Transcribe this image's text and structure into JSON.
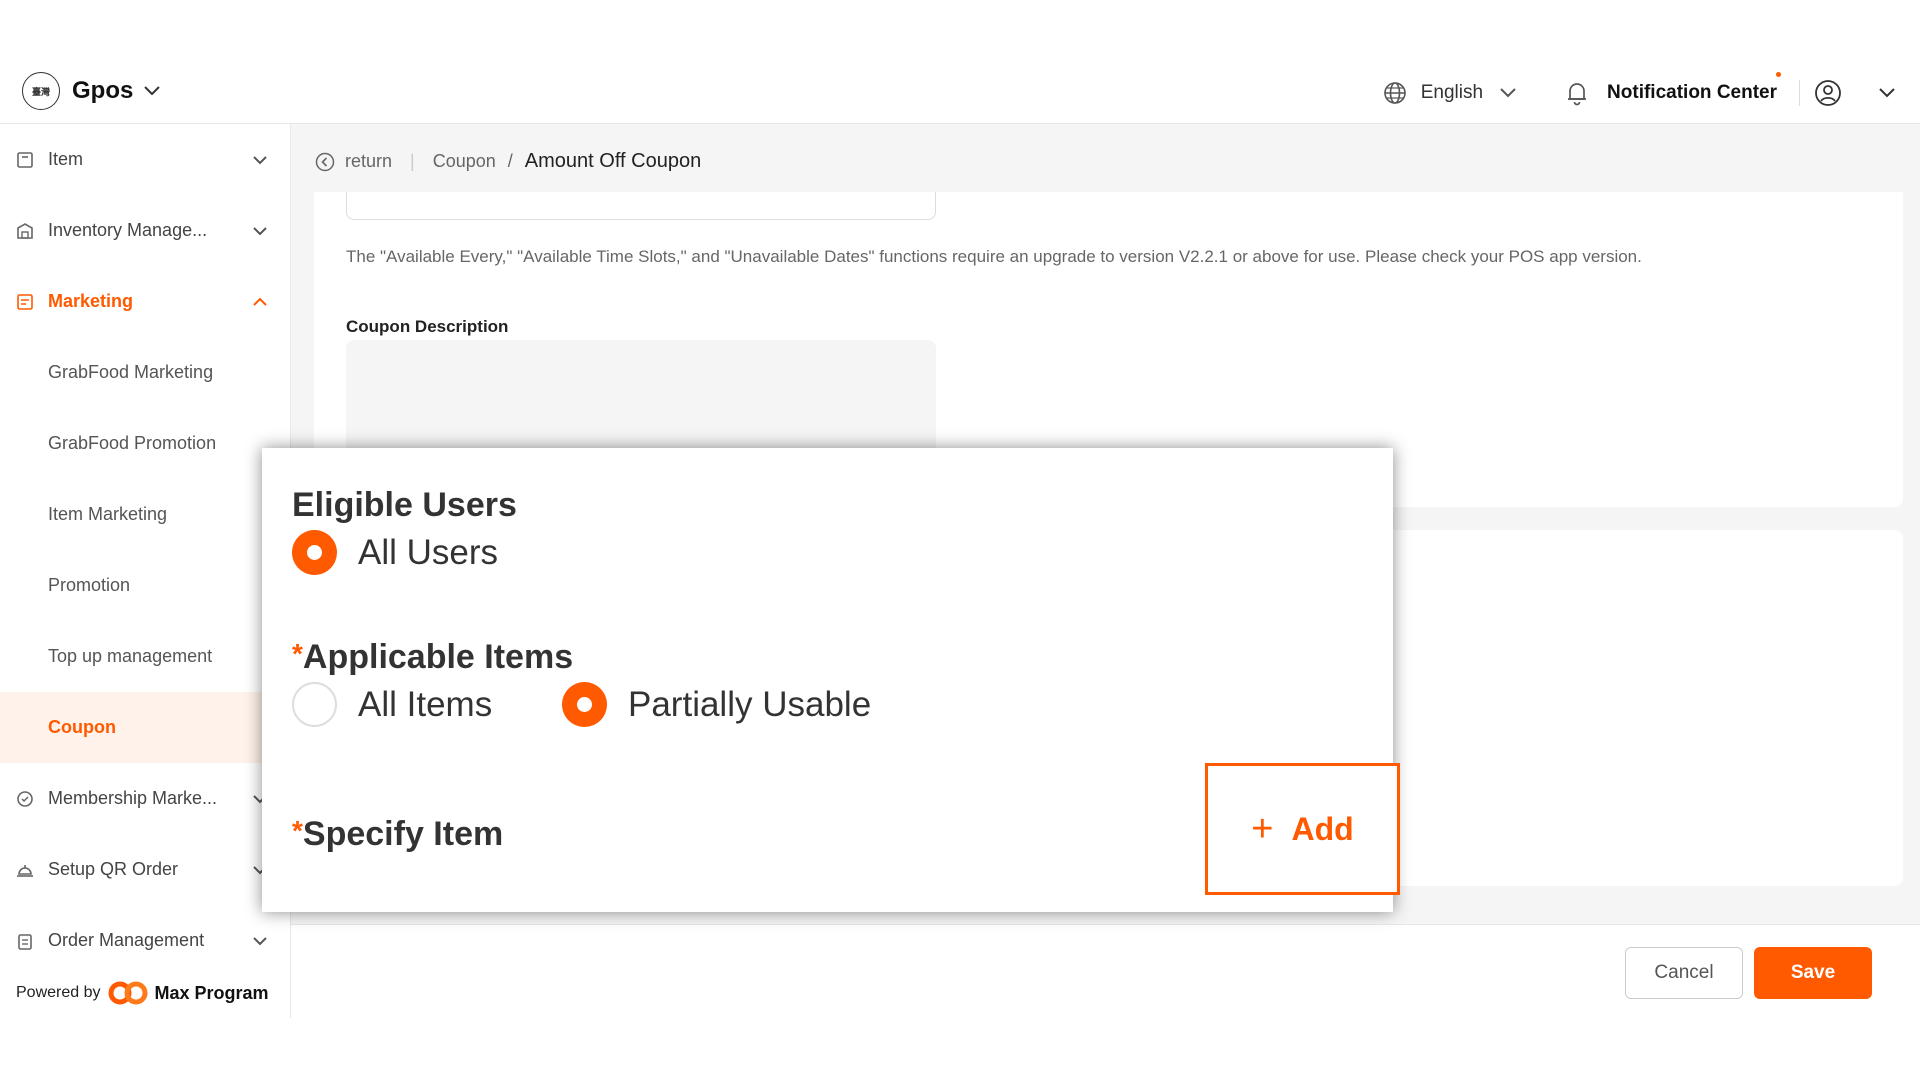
{
  "header": {
    "app_name": "Gpos",
    "logo_text": "臺灣",
    "language": "English",
    "notification_label": "Notification Center"
  },
  "sidebar": {
    "items": [
      {
        "label": "Item",
        "icon": "item-icon"
      },
      {
        "label": "Inventory Manage...",
        "icon": "warehouse-icon"
      },
      {
        "label": "Marketing",
        "icon": "marketing-icon"
      },
      {
        "label": "Membership Marke...",
        "icon": "membership-icon"
      },
      {
        "label": "Setup QR Order",
        "icon": "cloche-icon"
      },
      {
        "label": "Order Management",
        "icon": "clipboard-icon"
      }
    ],
    "marketing_sub": [
      "GrabFood Marketing",
      "GrabFood Promotion",
      "Item Marketing",
      "Promotion",
      "Top up management",
      "Coupon"
    ],
    "powered_by": "Powered by",
    "powered_brand": "Max Program"
  },
  "breadcrumb": {
    "return": "return",
    "parent": "Coupon",
    "current": "Amount Off Coupon"
  },
  "form": {
    "version_note": "The \"Available Every,\" \"Available Time Slots,\" and \"Unavailable Dates\" functions require an upgrade to version V2.2.1 or above for use. Please check your POS app version.",
    "description_label": "Coupon Description"
  },
  "zoom": {
    "eligible_users_label": "Eligible Users",
    "all_users": "All Users",
    "applicable_items_label": "Applicable Items",
    "all_items": "All Items",
    "partially_usable": "Partially Usable",
    "specify_item_label": "Specify Item",
    "add_label": "Add",
    "required_mark": "*",
    "plus_glyph": "+",
    "eligible_users_selected": "All Users",
    "applicable_items_selected": "Partially Usable"
  },
  "footer": {
    "cancel": "Cancel",
    "save": "Save"
  },
  "colors": {
    "accent": "#ff5a00",
    "selected_bg": "#fff2ea"
  }
}
